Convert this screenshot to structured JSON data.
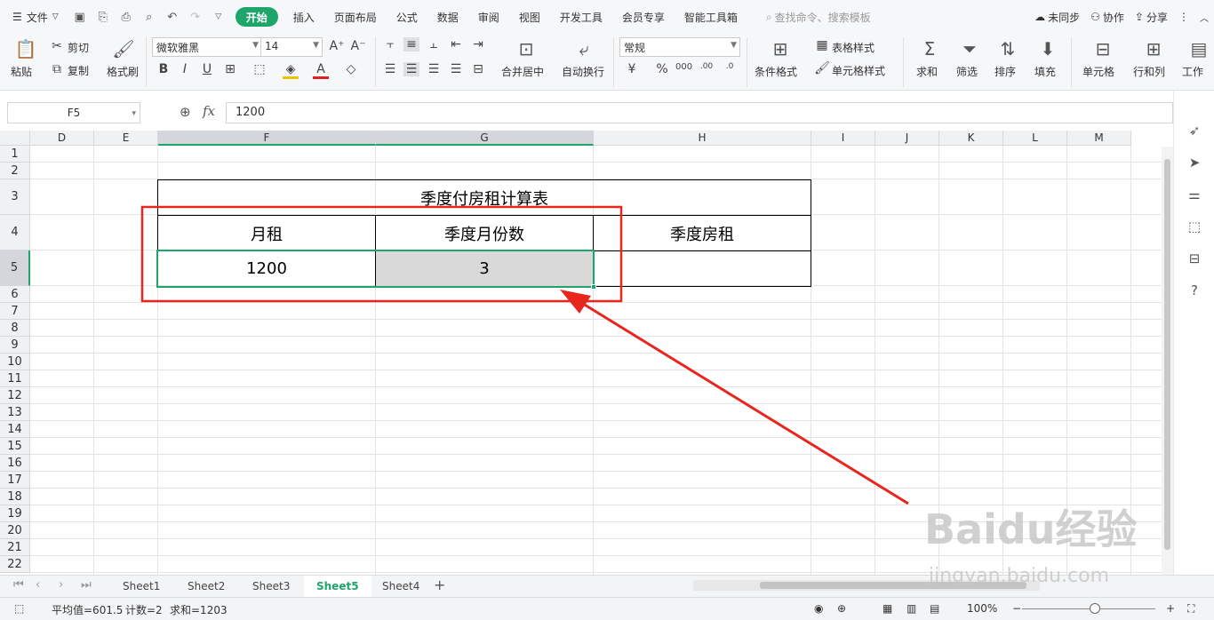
{
  "menu": {
    "file": "文件",
    "tabs": [
      "开始",
      "插入",
      "页面布局",
      "公式",
      "数据",
      "审阅",
      "视图",
      "开发工具",
      "会员专享",
      "智能工具箱"
    ],
    "active_tab": "开始",
    "search_placeholder": "查找命令、搜索模板",
    "sync": "未同步",
    "collab": "协作",
    "share": "分享"
  },
  "ribbon": {
    "paste": "粘贴",
    "cut": "剪切",
    "copy": "复制",
    "format_painter": "格式刷",
    "font_name": "微软雅黑",
    "font_size": "14",
    "merge_center": "合并居中",
    "wrap_text": "自动换行",
    "number_format": "常规",
    "cond_format": "条件格式",
    "table_style": "表格样式",
    "cell_style": "单元格样式",
    "sum": "求和",
    "filter": "筛选",
    "sort": "排序",
    "fill": "填充",
    "cell": "单元格",
    "row_col": "行和列",
    "worksheet": "工作"
  },
  "formula_bar": {
    "name_box": "F5",
    "fx": "fx",
    "value": "1200"
  },
  "grid": {
    "columns": [
      "D",
      "E",
      "F",
      "G",
      "H",
      "I",
      "J",
      "K",
      "L",
      "M"
    ],
    "rows": [
      "1",
      "2",
      "3",
      "4",
      "5",
      "6",
      "7",
      "8",
      "9",
      "10",
      "11",
      "12",
      "13",
      "14",
      "15",
      "16",
      "17",
      "18",
      "19",
      "20",
      "21",
      "22"
    ],
    "table_title": "季度付房租计算表",
    "headers": [
      "月租",
      "季度月份数",
      "季度房租"
    ],
    "values": [
      "1200",
      "3",
      ""
    ]
  },
  "sheets": {
    "tabs": [
      "Sheet1",
      "Sheet2",
      "Sheet3",
      "Sheet5",
      "Sheet4"
    ],
    "active": "Sheet5"
  },
  "status": {
    "average": "平均值=601.5",
    "count": "计数=2",
    "sum": "求和=1203",
    "zoom": "100%"
  },
  "watermark": {
    "brand": "Baidu经验",
    "url": "jingyan.baidu.com"
  },
  "colors": {
    "accent": "#1ea56b",
    "annotation": "#e8261e",
    "selected_cell_fill": "#d9d9d9"
  }
}
